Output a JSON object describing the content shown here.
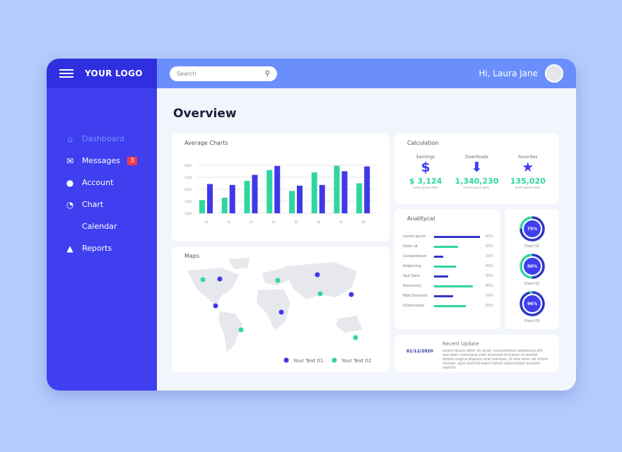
{
  "header": {
    "logo": "YOUR LOGO",
    "search_placeholder": "Search",
    "greeting": "Hi, Laura Jane"
  },
  "page_title": "Overview",
  "sidebar": {
    "items": [
      {
        "label": "Dashboard",
        "icon": "home-icon",
        "active": true
      },
      {
        "label": "Messages",
        "icon": "mail-icon",
        "badge": "3"
      },
      {
        "label": "Account",
        "icon": "user-icon"
      },
      {
        "label": "Chart",
        "icon": "pie-chart-icon"
      },
      {
        "label": "Calendar",
        "icon": "calendar-icon"
      },
      {
        "label": "Reports",
        "icon": "warning-icon"
      }
    ]
  },
  "colors": {
    "sidebar": "#3f3ff0",
    "header": "#6a8ffc",
    "green": "#2fd6a0",
    "blue": "#4038e8"
  },
  "chart_data": {
    "type": "bar",
    "title": "Average Charts",
    "categories": [
      "01",
      "02",
      "03",
      "04",
      "05",
      "06",
      "07",
      "08"
    ],
    "yticks": [
      "3000",
      "2500",
      "2000",
      "1500",
      "1000"
    ],
    "ylim": [
      1000,
      3000
    ],
    "grid": true,
    "series": [
      {
        "color": "#2fd6a0",
        "values": [
          1550,
          1650,
          2350,
          2800,
          1930,
          2700,
          2980,
          2250
        ]
      },
      {
        "color": "#4038e8",
        "values": [
          2220,
          2180,
          2600,
          2970,
          2150,
          2180,
          2750,
          2950
        ]
      }
    ]
  },
  "calculation": {
    "title": "Calculation",
    "items": [
      {
        "label": "Earnings",
        "value": "$ 3,124",
        "icon": "dollar-icon",
        "sub": "lorem ipsum dolor"
      },
      {
        "label": "Downloads",
        "value": "1,340,230",
        "icon": "arrow-down-icon",
        "sub": "lorem ipsum dolor"
      },
      {
        "label": "Favorites",
        "value": "135,020",
        "icon": "star-icon",
        "sub": "lorem ipsum dolor"
      }
    ]
  },
  "analytical": {
    "title": "Analitycal",
    "rows": [
      {
        "label": "Lorem Ipsum",
        "pct": 95
      },
      {
        "label": "Dolor sit",
        "pct": 50
      },
      {
        "label": "Consectetuer",
        "pct": 20
      },
      {
        "label": "Adipiscing",
        "pct": 45
      },
      {
        "label": "Sed Diam",
        "pct": 30
      },
      {
        "label": "Nonummy",
        "pct": 80
      },
      {
        "label": "Nibh Euismod",
        "pct": 39
      },
      {
        "label": "Ullamcorper",
        "pct": 65
      }
    ]
  },
  "donuts": [
    {
      "label": "Chart 01",
      "pct": 75,
      "text": "75%"
    },
    {
      "label": "Chart 02",
      "pct": 50,
      "text": "50%"
    },
    {
      "label": "Chart 03",
      "pct": 96,
      "text": "96%"
    }
  ],
  "maps": {
    "title": "Maps",
    "legend": [
      "Your Text 01",
      "Your Text 02"
    ]
  },
  "recent": {
    "title": "Recent Update",
    "date": "01/12/2020",
    "text": "Lorem ipsum dolor sit amet, consectetuer adipiscing elit, sed diam nonummy nibh euismod tincidunt ut laoreet dolore magna aliquam erat volutpat. Ut wisi enim ad minim veniam, quis nostrud exerci tation ullamcorper suscipit lobortis"
  }
}
